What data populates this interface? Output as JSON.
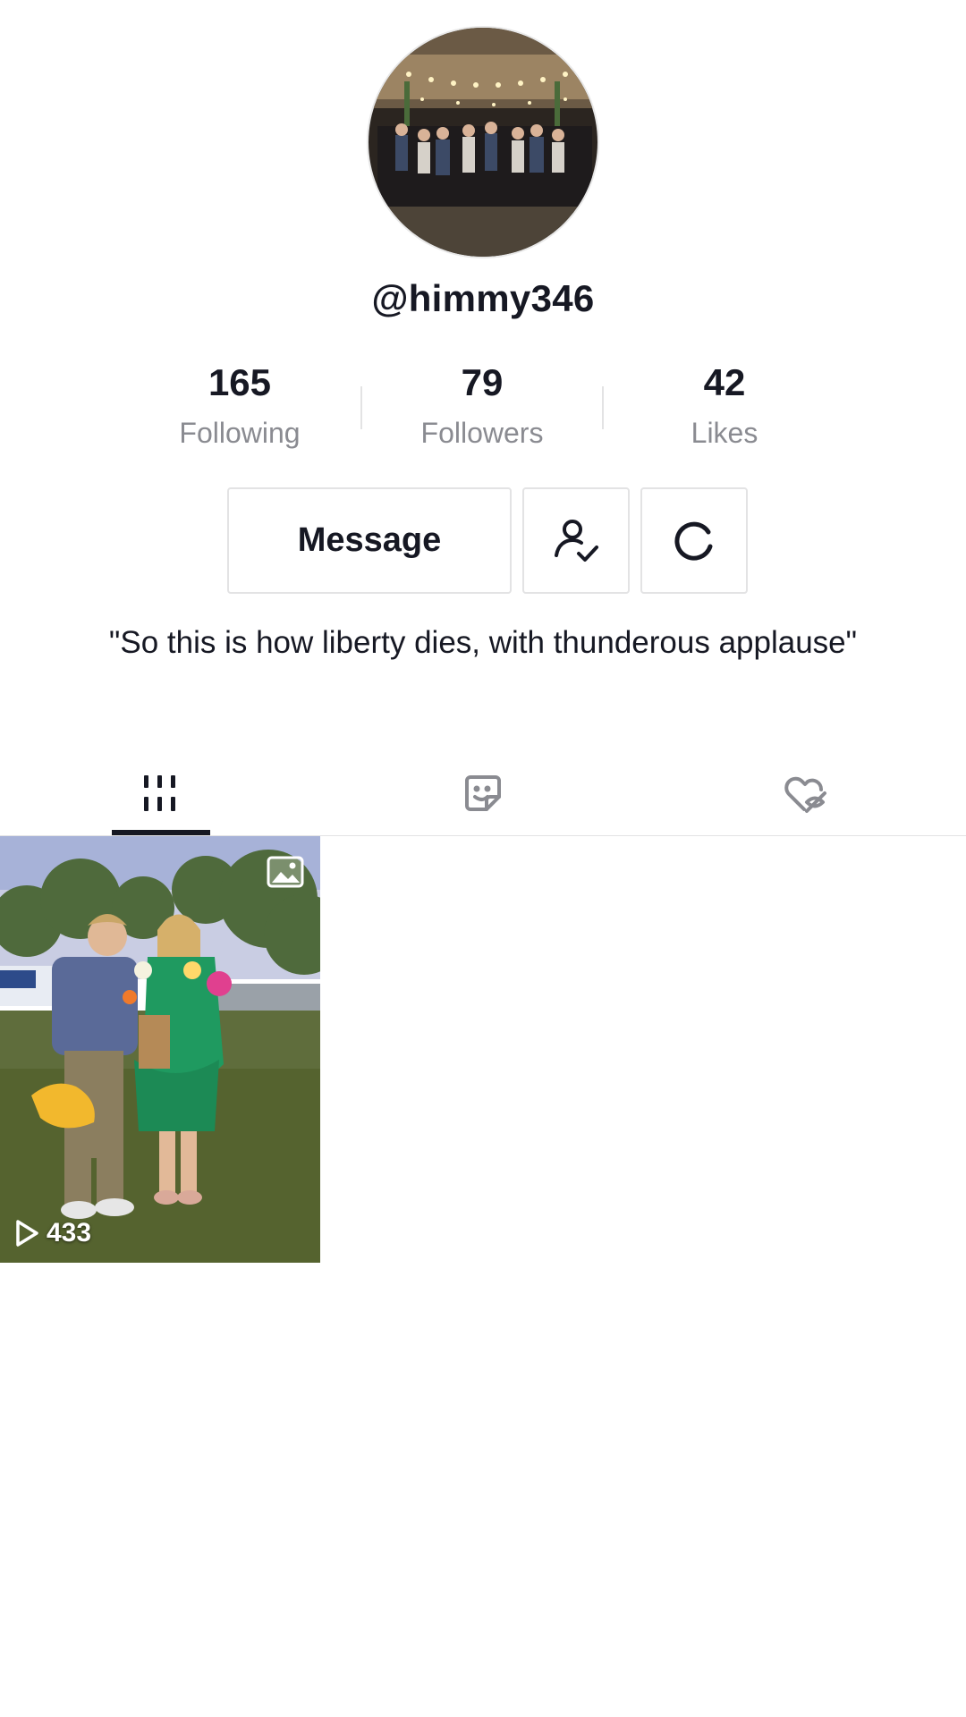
{
  "profile": {
    "username": "@himmy346",
    "bio": "\"So this is how liberty dies, with thunderous applause\""
  },
  "stats": {
    "following": {
      "value": "165",
      "label": "Following"
    },
    "followers": {
      "value": "79",
      "label": "Followers"
    },
    "likes": {
      "value": "42",
      "label": "Likes"
    }
  },
  "actions": {
    "message_label": "Message",
    "friend_icon": "user-check-icon",
    "refresh_icon": "refresh-icon"
  },
  "tabs": [
    {
      "name": "videos",
      "icon": "grid-icon",
      "active": true
    },
    {
      "name": "reposts",
      "icon": "sticker-icon",
      "active": false
    },
    {
      "name": "liked",
      "icon": "heart-hidden-icon",
      "active": false
    }
  ],
  "videos": [
    {
      "views": "433",
      "type_icon": "photo-icon"
    }
  ],
  "colors": {
    "text": "#161823",
    "secondary_text": "#8a8b91",
    "border": "#e3e3e4"
  }
}
